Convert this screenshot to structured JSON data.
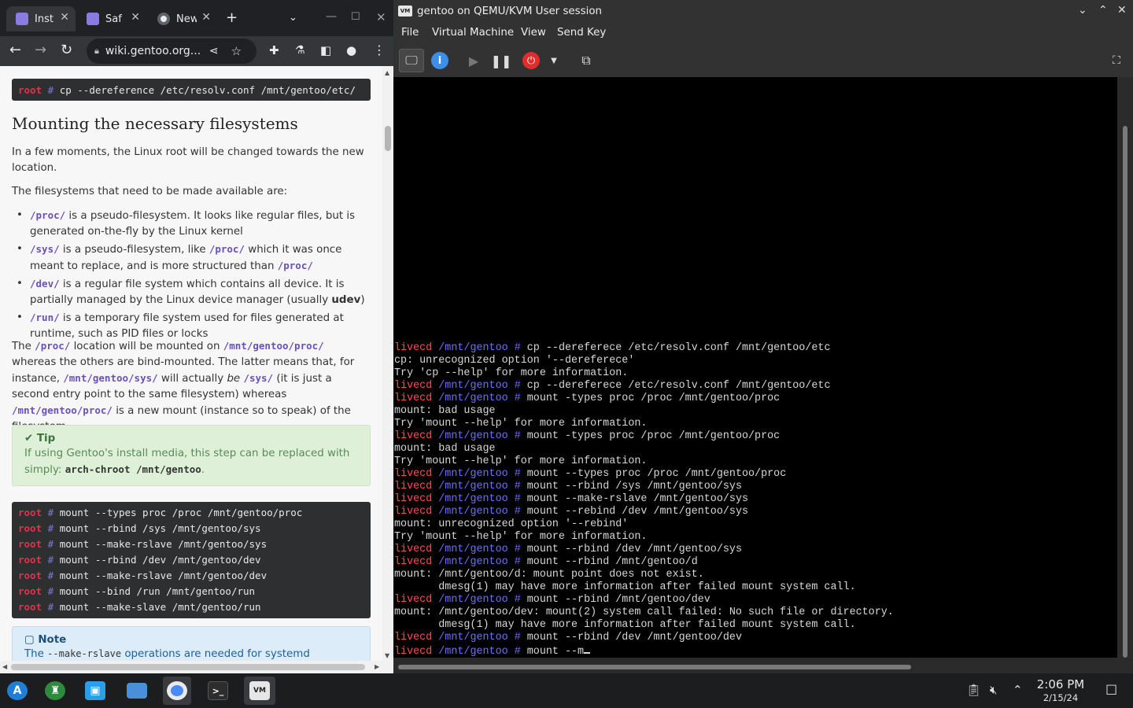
{
  "browser": {
    "tabs": [
      {
        "label": "Inst",
        "icon": "gentoo-favicon"
      },
      {
        "label": "Saf",
        "icon": "gentoo-favicon"
      },
      {
        "label": "New",
        "icon": "chrome-favicon"
      }
    ],
    "url": "wiki.gentoo.org...",
    "top_code": {
      "prompt_user": "root",
      "prompt_hash": "#",
      "command": "cp --dereference /etc/resolv.conf /mnt/gentoo/etc/"
    },
    "heading": "Mounting the necessary filesystems",
    "intro": "In a few moments, the Linux root will be changed towards the new location.",
    "fs_intro": "The filesystems that need to be made available are:",
    "bullets": [
      {
        "code": "/proc/",
        "text": " is a pseudo-filesystem. It looks like regular files, but is generated on-the-fly by the Linux kernel"
      },
      {
        "code": "/sys/",
        "text": " is a pseudo-filesystem, like ",
        "code2": "/proc/",
        "text2": " which it was once meant to replace, and is more structured than ",
        "code3": "/proc/"
      },
      {
        "code": "/dev/",
        "text": " is a regular file system which contains all device. It is partially managed by the Linux device manager (usually ",
        "bold": "udev",
        "text2": ")"
      },
      {
        "code": "/run/",
        "text": " is a temporary file system used for files generated at runtime, such as PID files or locks"
      }
    ],
    "para": {
      "t1": "The ",
      "c1": "/proc/",
      "t2": " location will be mounted on ",
      "c2": "/mnt/gentoo/proc/",
      "t3": " whereas the others are bind-mounted. The latter means that, for instance, ",
      "c3": "/mnt/gentoo/sys/",
      "t4": " will actually ",
      "em": "be",
      "t5": " ",
      "c4": "/sys/",
      "t6": " (it is just a second entry point to the same filesystem) whereas ",
      "c5": "/mnt/gentoo/proc/",
      "t7": " is a new mount (instance so to speak) of the filesystem."
    },
    "tip": {
      "title": "Tip",
      "body": "If using Gentoo's install media, this step can be replaced with simply: ",
      "code": "arch-chroot /mnt/gentoo",
      "after": "."
    },
    "code_block": {
      "prompt_user": "root",
      "prompt_hash": "#",
      "lines": [
        "mount --types proc /proc /mnt/gentoo/proc",
        "mount --rbind /sys /mnt/gentoo/sys",
        "mount --make-rslave /mnt/gentoo/sys",
        "mount --rbind /dev /mnt/gentoo/dev",
        "mount --make-rslave /mnt/gentoo/dev",
        "mount --bind /run /mnt/gentoo/run",
        "mount --make-slave /mnt/gentoo/run"
      ]
    },
    "note": {
      "title": "Note",
      "body_start": "The ",
      "code": "--make-rslave",
      "body_end": " operations are needed for systemd"
    }
  },
  "vm": {
    "title": "gentoo on QEMU/KVM User session",
    "app_icon_text": "VM",
    "menu": [
      "File",
      "Virtual Machine",
      "View",
      "Send Key"
    ],
    "terminal": [
      {
        "type": "prompt",
        "user": "livecd",
        "path": "/mnt/gentoo #",
        "cmd": " cp --dereferece /etc/resolv.conf /mnt/gentoo/etc"
      },
      {
        "type": "out",
        "text": "cp: unrecognized option '--dereferece'"
      },
      {
        "type": "out",
        "text": "Try 'cp --help' for more information."
      },
      {
        "type": "prompt",
        "user": "livecd",
        "path": "/mnt/gentoo #",
        "cmd": " cp --dereferece /etc/resolv.conf /mnt/gentoo/etc"
      },
      {
        "type": "prompt",
        "user": "livecd",
        "path": "/mnt/gentoo #",
        "cmd": " mount -types proc /proc /mnt/gentoo/proc"
      },
      {
        "type": "out",
        "text": "mount: bad usage"
      },
      {
        "type": "out",
        "text": "Try 'mount --help' for more information."
      },
      {
        "type": "prompt",
        "user": "livecd",
        "path": "/mnt/gentoo #",
        "cmd": " mount -types proc /proc /mnt/gentoo/proc"
      },
      {
        "type": "out",
        "text": "mount: bad usage"
      },
      {
        "type": "out",
        "text": "Try 'mount --help' for more information."
      },
      {
        "type": "prompt",
        "user": "livecd",
        "path": "/mnt/gentoo #",
        "cmd": " mount --types proc /proc /mnt/gentoo/proc"
      },
      {
        "type": "prompt",
        "user": "livecd",
        "path": "/mnt/gentoo #",
        "cmd": " mount --rbind /sys /mnt/gentoo/sys"
      },
      {
        "type": "prompt",
        "user": "livecd",
        "path": "/mnt/gentoo #",
        "cmd": " mount --make-rslave /mnt/gentoo/sys"
      },
      {
        "type": "prompt",
        "user": "livecd",
        "path": "/mnt/gentoo #",
        "cmd": " mount --rebind /dev /mnt/gentoo/sys"
      },
      {
        "type": "out",
        "text": "mount: unrecognized option '--rebind'"
      },
      {
        "type": "out",
        "text": "Try 'mount --help' for more information."
      },
      {
        "type": "prompt",
        "user": "livecd",
        "path": "/mnt/gentoo #",
        "cmd": " mount --rbind /dev /mnt/gentoo/sys"
      },
      {
        "type": "prompt",
        "user": "livecd",
        "path": "/mnt/gentoo #",
        "cmd": " mount --rbind /mnt/gentoo/d"
      },
      {
        "type": "out",
        "text": "mount: /mnt/gentoo/d: mount point does not exist."
      },
      {
        "type": "out",
        "text": "       dmesg(1) may have more information after failed mount system call."
      },
      {
        "type": "prompt",
        "user": "livecd",
        "path": "/mnt/gentoo #",
        "cmd": " mount --rbind /mnt/gentoo/dev"
      },
      {
        "type": "out",
        "text": "mount: /mnt/gentoo/dev: mount(2) system call failed: No such file or directory."
      },
      {
        "type": "out",
        "text": "       dmesg(1) may have more information after failed mount system call."
      },
      {
        "type": "prompt",
        "user": "livecd",
        "path": "/mnt/gentoo #",
        "cmd": " mount --rbind /dev /mnt/gentoo/dev"
      },
      {
        "type": "prompt",
        "user": "livecd",
        "path": "/mnt/gentoo #",
        "cmd": " mount --m",
        "cursor": true
      }
    ]
  },
  "taskbar": {
    "time": "2:06 PM",
    "date": "2/15/24"
  },
  "colors": {
    "prompt_user": "#ff4d4d",
    "prompt_path": "#6f6fff",
    "root_kw": "#e0334b",
    "code_purple": "#6b4fbb",
    "tip_bg": "#dff0d8",
    "note_bg": "#dcecf8"
  }
}
